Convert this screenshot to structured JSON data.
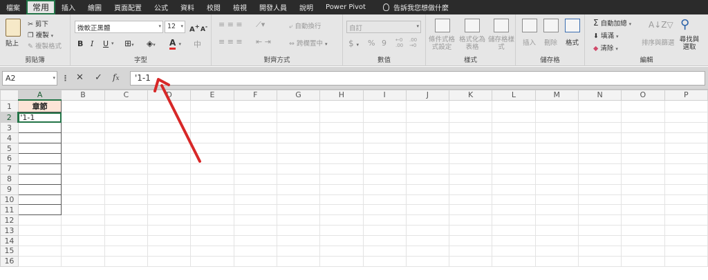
{
  "tabs": [
    "檔案",
    "常用",
    "插入",
    "繪圖",
    "頁面配置",
    "公式",
    "資料",
    "校閱",
    "檢視",
    "開發人員",
    "說明",
    "Power Pivot"
  ],
  "active_tab": 1,
  "tell_me": "告訴我您想做什麼",
  "clipboard": {
    "paste": "貼上",
    "cut": "剪下",
    "copy": "複製",
    "format_painter": "複製格式",
    "label": "剪貼簿"
  },
  "font": {
    "name": "微軟正黑體",
    "size": "12",
    "label": "字型",
    "bold": "B",
    "italic": "I",
    "underline": "U",
    "grow": "A",
    "shrink": "A",
    "font_color": "A",
    "font_color_hex": "#e02b2b"
  },
  "alignment": {
    "wrap": "自動換行",
    "merge": "跨欄置中",
    "label": "對齊方式"
  },
  "number": {
    "format": "自訂",
    "currency": "$",
    "percent": "%",
    "comma": "9",
    "label": "數值"
  },
  "styles": {
    "conditional": "條件式格式設定",
    "table": "格式化為表格",
    "cell": "儲存格樣式",
    "label": "樣式"
  },
  "cells": {
    "insert": "插入",
    "delete": "刪除",
    "format": "格式",
    "label": "儲存格"
  },
  "editing": {
    "autosum": "自動加總",
    "fill": "填滿",
    "clear": "清除",
    "sort": "排序與篩選",
    "find": "尋找與選取",
    "label": "編輯"
  },
  "name_box": "A2",
  "formula_value": "'1-1",
  "columns": [
    "A",
    "B",
    "C",
    "D",
    "E",
    "F",
    "G",
    "H",
    "I",
    "J",
    "K",
    "L",
    "M",
    "N",
    "O",
    "P"
  ],
  "rows": [
    "1",
    "2",
    "3",
    "4",
    "5",
    "6",
    "7",
    "8",
    "9",
    "10",
    "11",
    "12",
    "13",
    "14",
    "15",
    "16"
  ],
  "cells_data": {
    "A1": "章節",
    "A2": "'1-1"
  },
  "annotation_color": "#d72828"
}
